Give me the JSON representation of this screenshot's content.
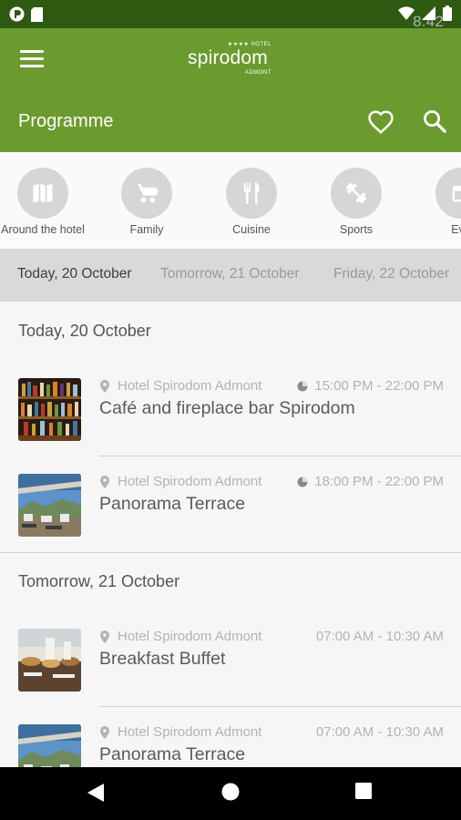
{
  "status_bar": {
    "time": "8:42",
    "left_icons": [
      "notification-icon",
      "sd-card-icon"
    ],
    "right_icons": [
      "wifi-icon",
      "signal-icon",
      "battery-icon"
    ]
  },
  "app_bar": {
    "logo": {
      "stars": "★★★★ HOTEL",
      "name": "spirodom",
      "place": "ADMONT"
    },
    "title": "Programme",
    "actions": [
      "heart-icon",
      "search-icon"
    ]
  },
  "categories": [
    {
      "label": "Around the hotel",
      "icon": "map-icon"
    },
    {
      "label": "Family",
      "icon": "stroller-icon"
    },
    {
      "label": "Cuisine",
      "icon": "cutlery-icon"
    },
    {
      "label": "Sports",
      "icon": "dumbbell-icon"
    },
    {
      "label": "Eve",
      "icon": "event-icon"
    }
  ],
  "date_tabs": [
    {
      "label": "Today, 20 October",
      "active": true
    },
    {
      "label": "Tomorrow, 21 October",
      "active": false
    },
    {
      "label": "Friday, 22 October",
      "active": false
    }
  ],
  "sections": [
    {
      "heading": "Today, 20 October",
      "items": [
        {
          "location": "Hotel Spirodom Admont",
          "time": "15:00 PM - 22:00 PM",
          "title": "Café and fireplace bar Spirodom",
          "thumb": "bar-shelves-photo",
          "live": true
        },
        {
          "location": "Hotel Spirodom Admont",
          "time": "18:00 PM - 22:00 PM",
          "title": "Panorama Terrace",
          "thumb": "terrace-photo",
          "live": true
        }
      ]
    },
    {
      "heading": "Tomorrow, 21 October",
      "items": [
        {
          "location": "Hotel Spirodom Admont",
          "time": "07:00 AM - 10:30 AM",
          "title": "Breakfast Buffet",
          "thumb": "buffet-photo",
          "live": false
        },
        {
          "location": "Hotel Spirodom Admont",
          "time": "07:00 AM - 10:30 AM",
          "title": "Panorama Terrace",
          "thumb": "terrace-photo",
          "live": false
        }
      ]
    }
  ],
  "colors": {
    "status_bar": "#2f5a12",
    "app_bar": "#6b9b2f",
    "date_tabs_bg": "#d9d9d9",
    "list_bg": "#f6f6f6"
  }
}
